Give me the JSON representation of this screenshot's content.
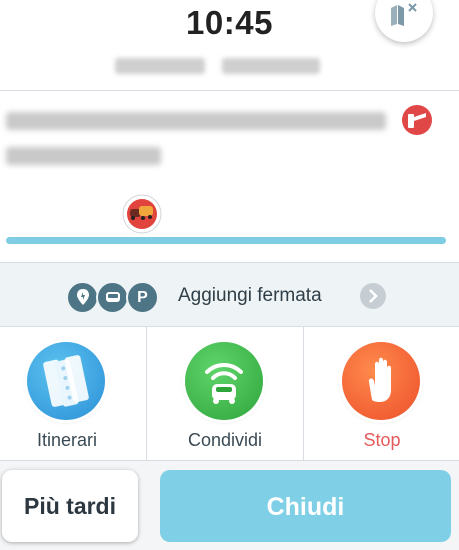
{
  "header": {
    "eta_time": "10:45"
  },
  "add_stop": {
    "label": "Aggiungi fermata",
    "badges": [
      "gas-station",
      "parking-lot",
      "P"
    ]
  },
  "actions": [
    {
      "label": "Itinerari",
      "icon": "routes-icon",
      "color": "#3aa6e3"
    },
    {
      "label": "Condividi",
      "icon": "share-car-icon",
      "color": "#3cb64a"
    },
    {
      "label": "Stop",
      "icon": "hand-stop-icon",
      "color": "#f2622e"
    }
  ],
  "buttons": {
    "later": "Più tardi",
    "close": "Chiudi"
  },
  "colors": {
    "accent": "#7fcfe6",
    "stop_text": "#e45a5a",
    "badge": "#4e7585"
  }
}
